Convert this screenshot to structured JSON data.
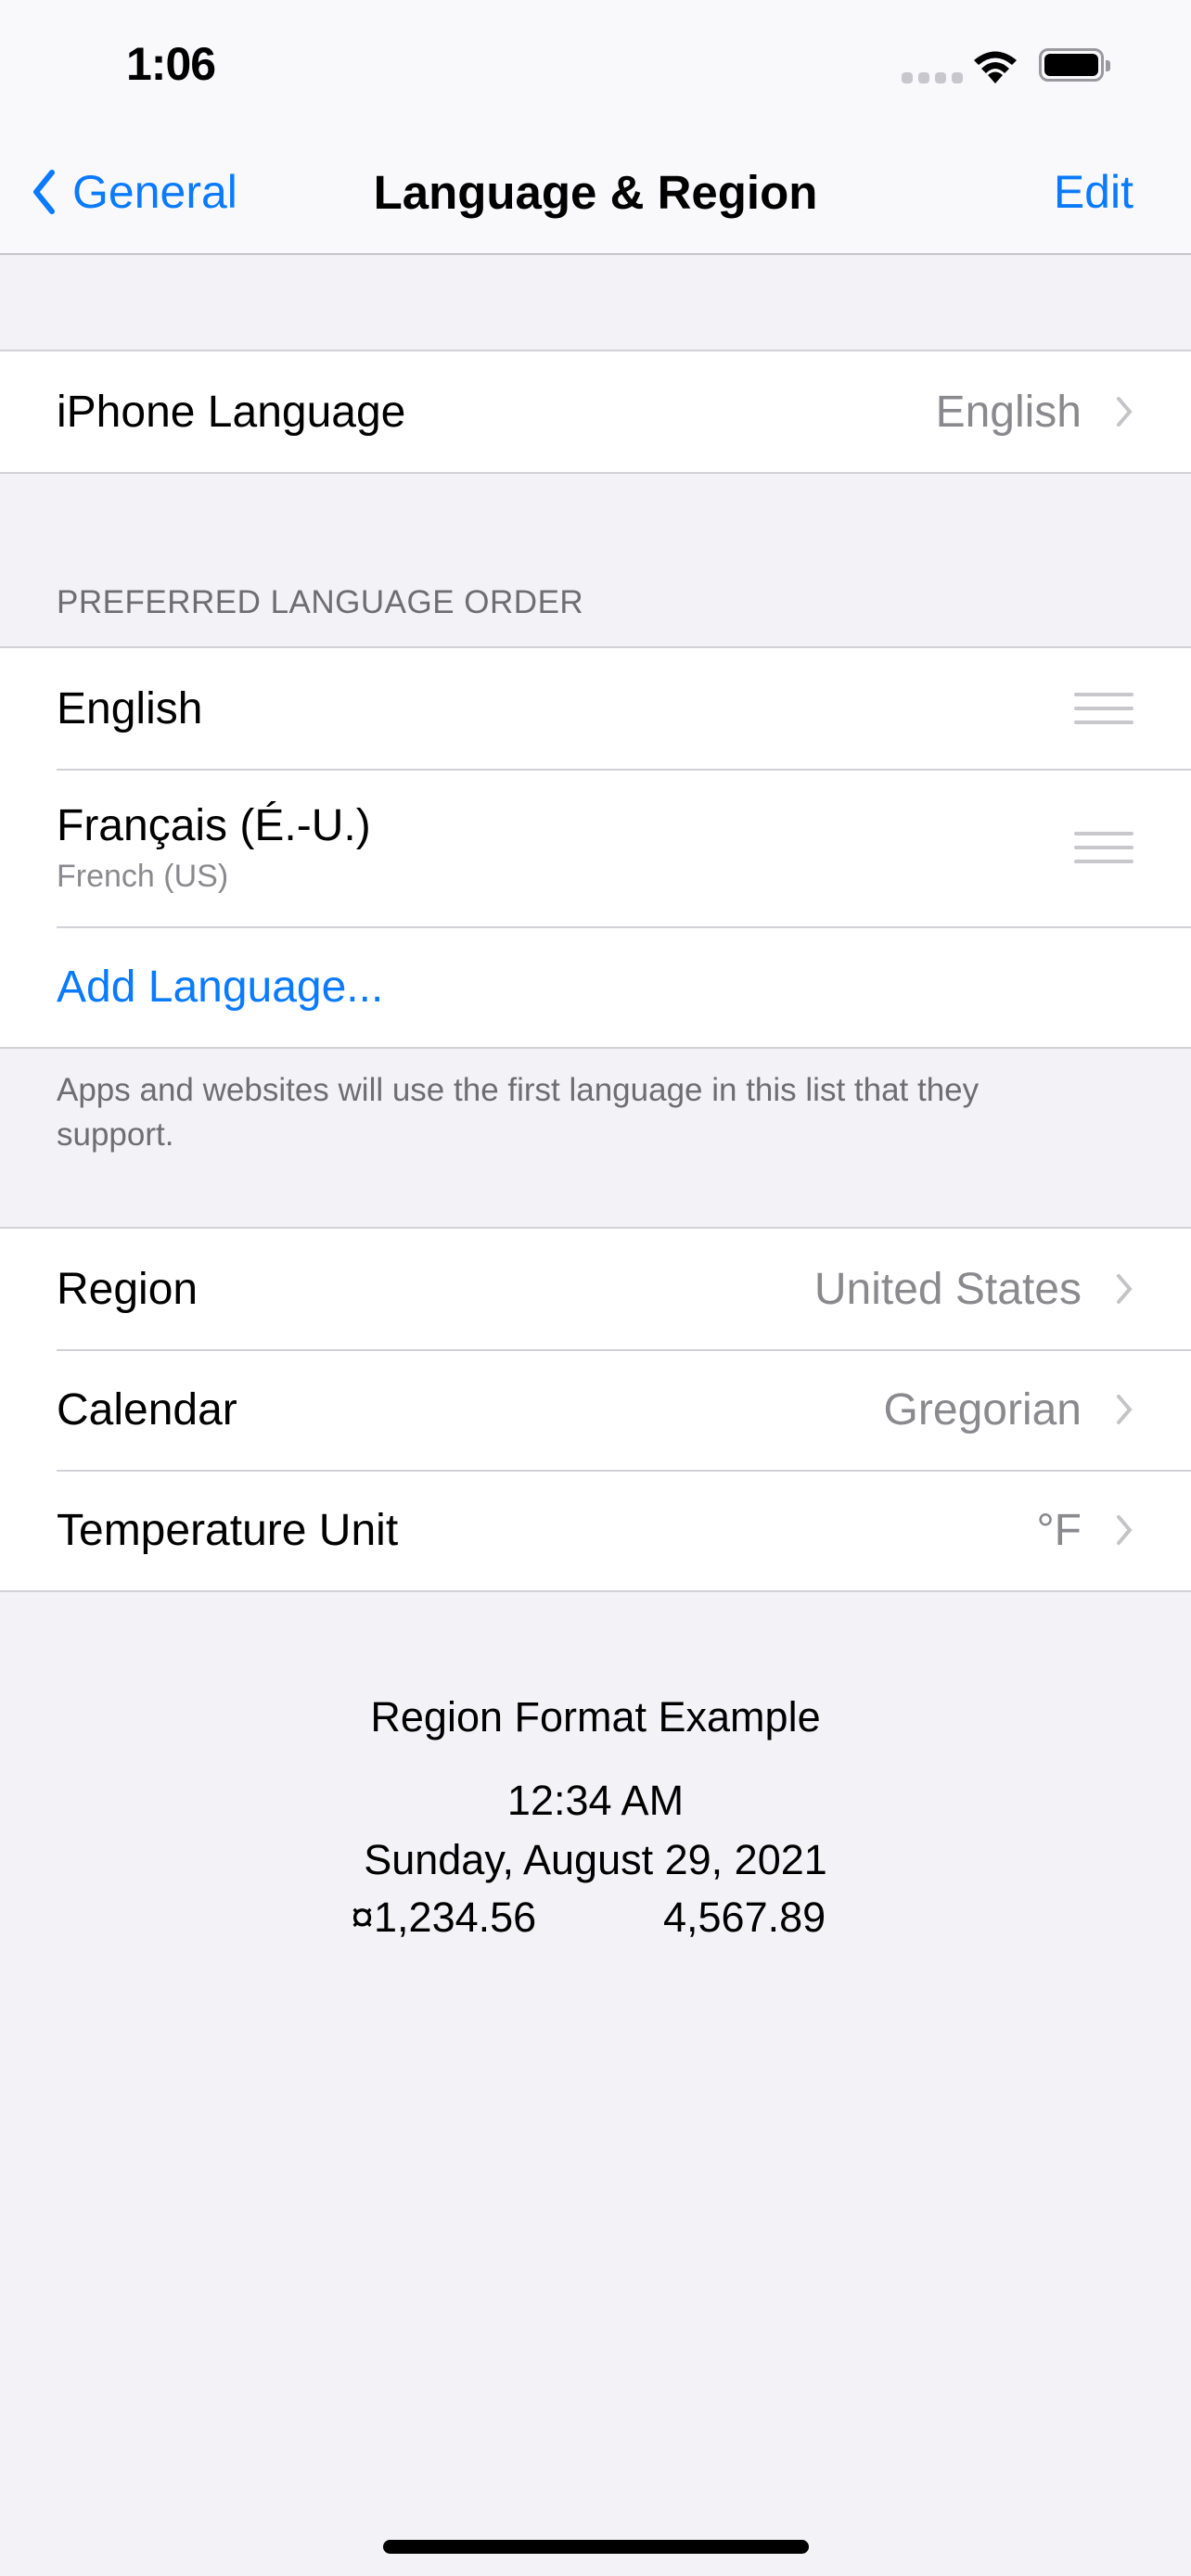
{
  "status_bar": {
    "time": "1:06"
  },
  "nav": {
    "back_label": "General",
    "title": "Language & Region",
    "edit_label": "Edit"
  },
  "iphone_language": {
    "label": "iPhone Language",
    "value": "English"
  },
  "preferred": {
    "header": "PREFERRED LANGUAGE ORDER",
    "languages": [
      {
        "name": "English"
      },
      {
        "name": "Français (É.-U.)",
        "subtitle": "French (US)"
      }
    ],
    "add_label": "Add Language...",
    "footer": "Apps and websites will use the first language in this list that they support."
  },
  "settings": [
    {
      "label": "Region",
      "value": "United States"
    },
    {
      "label": "Calendar",
      "value": "Gregorian"
    },
    {
      "label": "Temperature Unit",
      "value": "°F"
    }
  ],
  "region_example": {
    "title": "Region Format Example",
    "time": "12:34 AM",
    "date": "Sunday, August 29, 2021",
    "currency": "¤1,234.56",
    "number": "4,567.89"
  },
  "colors": {
    "accent": "#0a7aff",
    "secondary_text": "#8a8a8e",
    "background": "#f2f2f7"
  }
}
